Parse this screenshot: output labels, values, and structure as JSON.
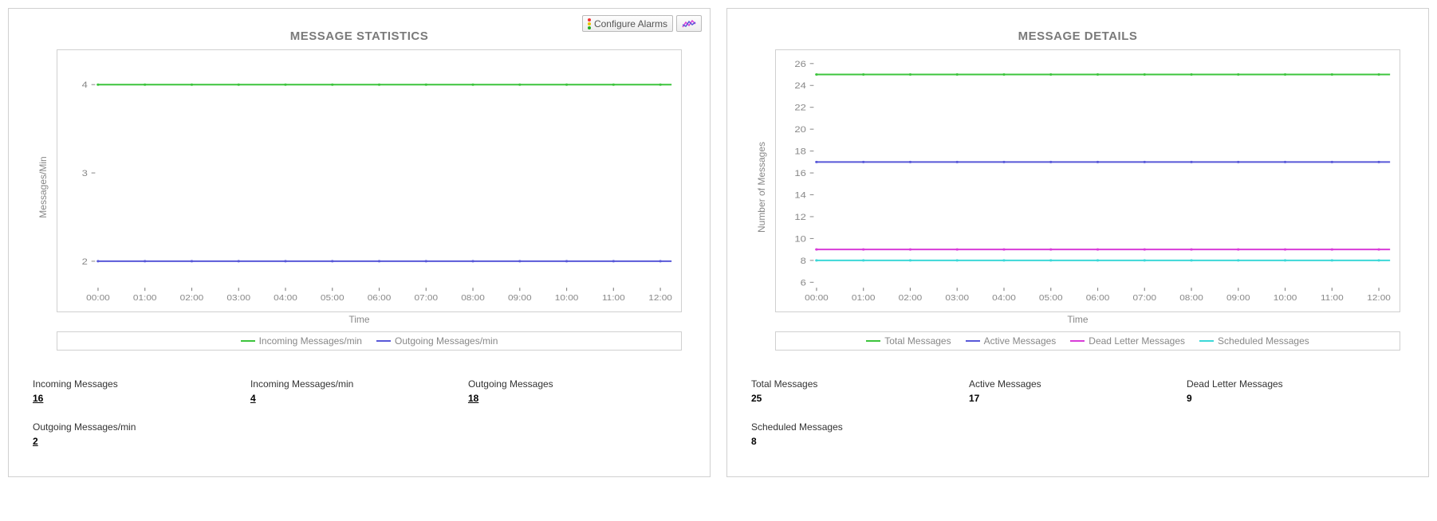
{
  "toolbar": {
    "configure_alarms": "Configure Alarms"
  },
  "left_panel": {
    "title": "MESSAGE STATISTICS",
    "ylabel": "Messages/Min",
    "xlabel": "Time",
    "stats": [
      {
        "label": "Incoming Messages",
        "value": "16",
        "link": true
      },
      {
        "label": "Incoming Messages/min",
        "value": "4",
        "link": true
      },
      {
        "label": "Outgoing Messages",
        "value": "18",
        "link": true
      },
      {
        "label": "Outgoing Messages/min",
        "value": "2",
        "link": true
      }
    ]
  },
  "right_panel": {
    "title": "MESSAGE DETAILS",
    "ylabel": "Number of Messages",
    "xlabel": "Time",
    "stats": [
      {
        "label": "Total Messages",
        "value": "25",
        "link": false
      },
      {
        "label": "Active Messages",
        "value": "17",
        "link": false
      },
      {
        "label": "Dead Letter Messages",
        "value": "9",
        "link": false
      },
      {
        "label": "Scheduled Messages",
        "value": "8",
        "link": false
      }
    ]
  },
  "chart_data": [
    {
      "type": "line",
      "title": "MESSAGE STATISTICS",
      "xlabel": "Time",
      "ylabel": "Messages/Min",
      "x_ticks": [
        "00:00",
        "01:00",
        "02:00",
        "03:00",
        "04:00",
        "05:00",
        "06:00",
        "07:00",
        "08:00",
        "09:00",
        "10:00",
        "11:00",
        "12:00"
      ],
      "y_ticks": [
        2,
        3,
        4
      ],
      "ylim": [
        1.7,
        4.3
      ],
      "series": [
        {
          "name": "Incoming Messages/min",
          "color": "#3cc43c",
          "values": [
            4,
            4,
            4,
            4,
            4,
            4,
            4,
            4,
            4,
            4,
            4,
            4,
            4
          ]
        },
        {
          "name": "Outgoing Messages/min",
          "color": "#5858d8",
          "values": [
            2,
            2,
            2,
            2,
            2,
            2,
            2,
            2,
            2,
            2,
            2,
            2,
            2
          ]
        }
      ]
    },
    {
      "type": "line",
      "title": "MESSAGE DETAILS",
      "xlabel": "Time",
      "ylabel": "Number of Messages",
      "x_ticks": [
        "00:00",
        "01:00",
        "02:00",
        "03:00",
        "04:00",
        "05:00",
        "06:00",
        "07:00",
        "08:00",
        "09:00",
        "10:00",
        "11:00",
        "12:00"
      ],
      "y_ticks": [
        6,
        8,
        10,
        12,
        14,
        16,
        18,
        20,
        22,
        24,
        26
      ],
      "ylim": [
        5.5,
        26.5
      ],
      "series": [
        {
          "name": "Total Messages",
          "color": "#3cc43c",
          "values": [
            25,
            25,
            25,
            25,
            25,
            25,
            25,
            25,
            25,
            25,
            25,
            25,
            25
          ]
        },
        {
          "name": "Active Messages",
          "color": "#5858d8",
          "values": [
            17,
            17,
            17,
            17,
            17,
            17,
            17,
            17,
            17,
            17,
            17,
            17,
            17
          ]
        },
        {
          "name": "Dead Letter Messages",
          "color": "#d83cd8",
          "values": [
            9,
            9,
            9,
            9,
            9,
            9,
            9,
            9,
            9,
            9,
            9,
            9,
            9
          ]
        },
        {
          "name": "Scheduled Messages",
          "color": "#3cd8d8",
          "values": [
            8,
            8,
            8,
            8,
            8,
            8,
            8,
            8,
            8,
            8,
            8,
            8,
            8
          ]
        }
      ]
    }
  ]
}
